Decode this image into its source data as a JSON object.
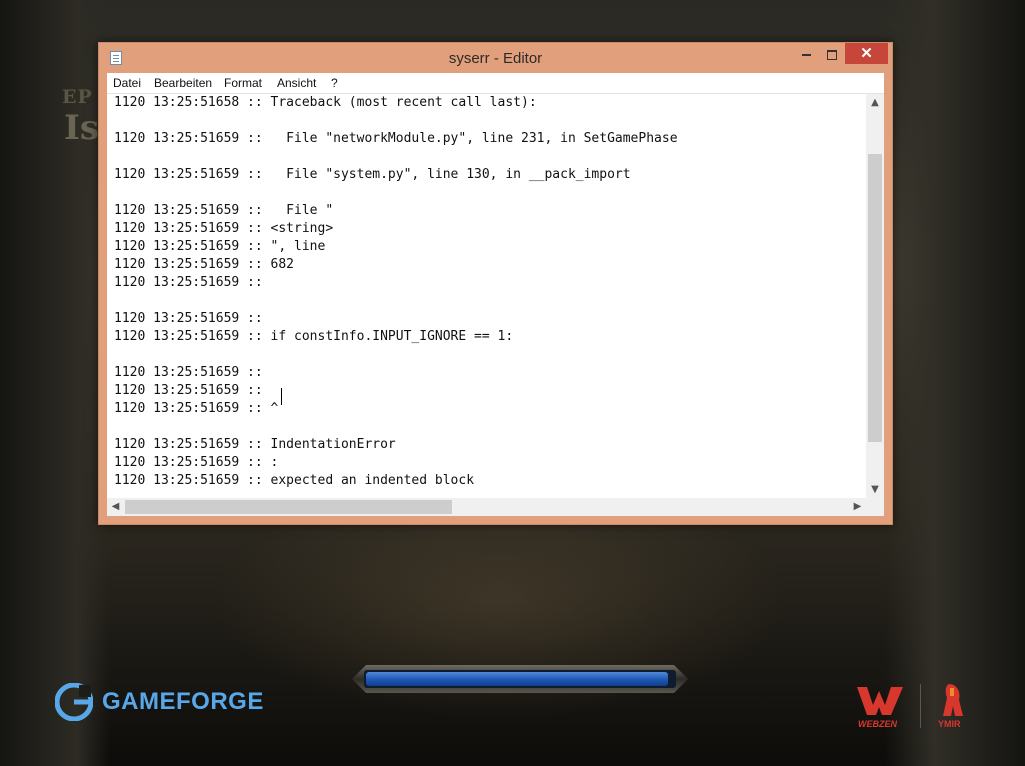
{
  "background": {
    "game_logo_small": "EP",
    "game_logo_big": "Is"
  },
  "window": {
    "title": "syserr - Editor",
    "controls": {
      "minimize": "",
      "maximize": "",
      "close": "✕"
    },
    "menu": [
      "Datei",
      "Bearbeiten",
      "Format",
      "Ansicht",
      "?"
    ]
  },
  "editor": {
    "lines": [
      "1120 13:25:51658 :: Traceback (most recent call last):",
      "",
      "1120 13:25:51659 ::   File \"networkModule.py\", line 231, in SetGamePhase",
      "",
      "1120 13:25:51659 ::   File \"system.py\", line 130, in __pack_import",
      "",
      "1120 13:25:51659 ::   File \"",
      "1120 13:25:51659 :: <string>",
      "1120 13:25:51659 :: \", line",
      "1120 13:25:51659 :: 682",
      "1120 13:25:51659 ::",
      "",
      "1120 13:25:51659 ::",
      "1120 13:25:51659 :: if constInfo.INPUT_IGNORE == 1:",
      "",
      "1120 13:25:51659 ::",
      "1120 13:25:51659 ::",
      "1120 13:25:51659 :: ^",
      "",
      "1120 13:25:51659 :: IndentationError",
      "1120 13:25:51659 :: :",
      "1120 13:25:51659 :: expected an indented block"
    ]
  },
  "scrollbars": {
    "up": "▲",
    "down": "▼",
    "left": "◀",
    "right": "▶"
  },
  "loading": {
    "progress": 0.98
  },
  "logos": {
    "gameforge": "GAMEFORGE",
    "webzen": "WEBZEN",
    "ymir": "YMIR"
  },
  "colors": {
    "window_frame": "#e29f7b",
    "close_button": "#c7463a",
    "loading_blue": "#1d57b4",
    "gameforge_blue": "#58a7e8",
    "webzen_red": "#d8372e"
  }
}
